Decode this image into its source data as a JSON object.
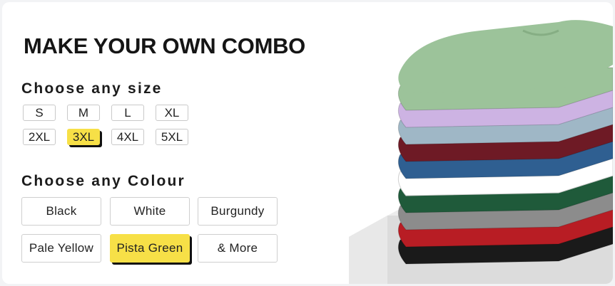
{
  "title": "MAKE YOUR OWN COMBO",
  "size_section": {
    "label": "Choose any size",
    "options": [
      "S",
      "M",
      "L",
      "XL",
      "2XL",
      "3XL",
      "4XL",
      "5XL"
    ],
    "selected": "3XL"
  },
  "colour_section": {
    "label": "Choose any Colour",
    "options": [
      "Black",
      "White",
      "Burgundy",
      "Pale Yellow",
      "Pista Green",
      "& More"
    ],
    "selected": "Pista Green"
  },
  "colors": {
    "accent": "#f7e047",
    "shirts": [
      "#9cc39a",
      "#cdb3e3",
      "#9fb7c6",
      "#6e1a25",
      "#2f5f91",
      "#ffffff",
      "#1f5a3a",
      "#8c8c8c",
      "#b81d24",
      "#1a1a1a"
    ]
  }
}
